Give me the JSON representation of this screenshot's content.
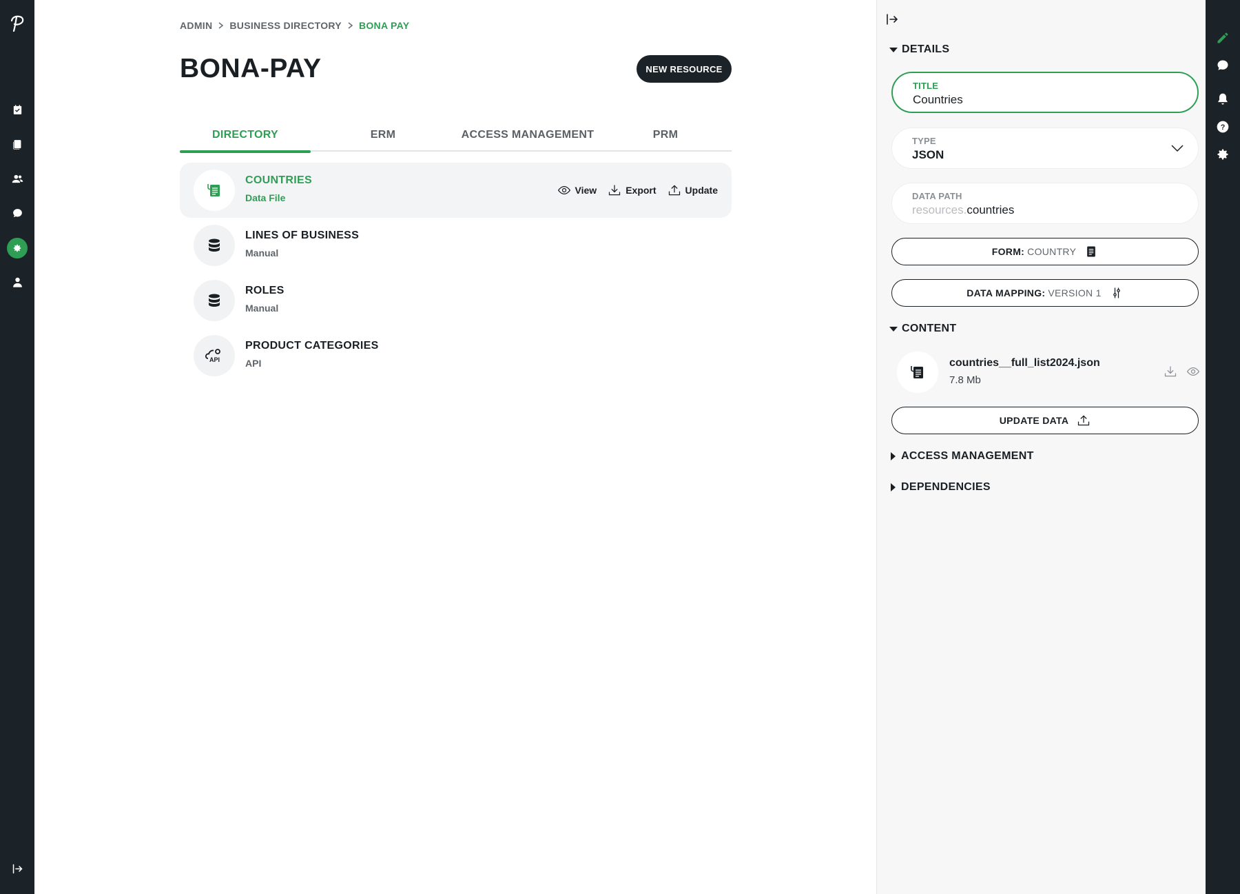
{
  "breadcrumb": {
    "items": [
      "ADMIN",
      "BUSINESS DIRECTORY"
    ],
    "current": "BONA PAY"
  },
  "page": {
    "title": "BONA-PAY",
    "new_resource_label": "NEW RESOURCE"
  },
  "tabs": [
    {
      "label": "DIRECTORY",
      "active": true
    },
    {
      "label": "ERM",
      "active": false
    },
    {
      "label": "ACCESS MANAGEMENT",
      "active": false
    },
    {
      "label": "PRM",
      "active": false
    }
  ],
  "resources": [
    {
      "name": "COUNTRIES",
      "subtitle": "Data File",
      "icon": "data-file-icon",
      "selected": true
    },
    {
      "name": "LINES OF BUSINESS",
      "subtitle": "Manual",
      "icon": "database-icon",
      "selected": false
    },
    {
      "name": "ROLES",
      "subtitle": "Manual",
      "icon": "database-icon",
      "selected": false
    },
    {
      "name": "PRODUCT CATEGORIES",
      "subtitle": "API",
      "icon": "api-cloud-icon",
      "selected": false
    }
  ],
  "resource_actions": {
    "view": "View",
    "export": "Export",
    "update": "Update"
  },
  "panel": {
    "details_heading": "DETAILS",
    "title_field": {
      "label": "TITLE",
      "value": "Countries"
    },
    "type_field": {
      "label": "TYPE",
      "value": "JSON"
    },
    "data_path_field": {
      "label": "DATA PATH",
      "prefix": "resources.",
      "value": "countries"
    },
    "form_button": {
      "label": "FORM:",
      "value": "COUNTRY"
    },
    "mapping_button": {
      "label": "DATA MAPPING:",
      "value": "VERSION 1"
    },
    "content_heading": "CONTENT",
    "file": {
      "name": "countries__full_list2024.json",
      "size": "7.8 Mb"
    },
    "update_data_label": "UPDATE DATA",
    "access_heading": "ACCESS MANAGEMENT",
    "dependencies_heading": "DEPENDENCIES"
  },
  "colors": {
    "accent": "#2f9e55",
    "rail": "#1b2328",
    "panel_bg": "#f7f7f8"
  }
}
